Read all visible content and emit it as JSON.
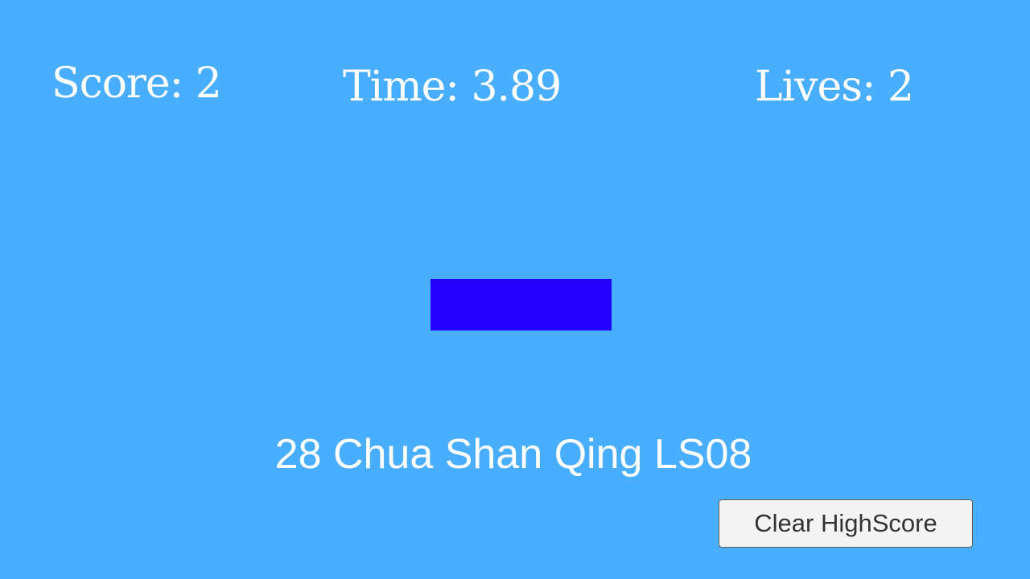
{
  "hud": {
    "score_text": "Score: 2",
    "time_text": "Time: 3.89",
    "lives_text": "Lives: 2"
  },
  "game": {
    "block_color": "#2800ff",
    "background_color": "#4aaeff"
  },
  "credit": {
    "text": "28 Chua Shan Qing LS08"
  },
  "buttons": {
    "clear_highscore_label": "Clear HighScore"
  }
}
